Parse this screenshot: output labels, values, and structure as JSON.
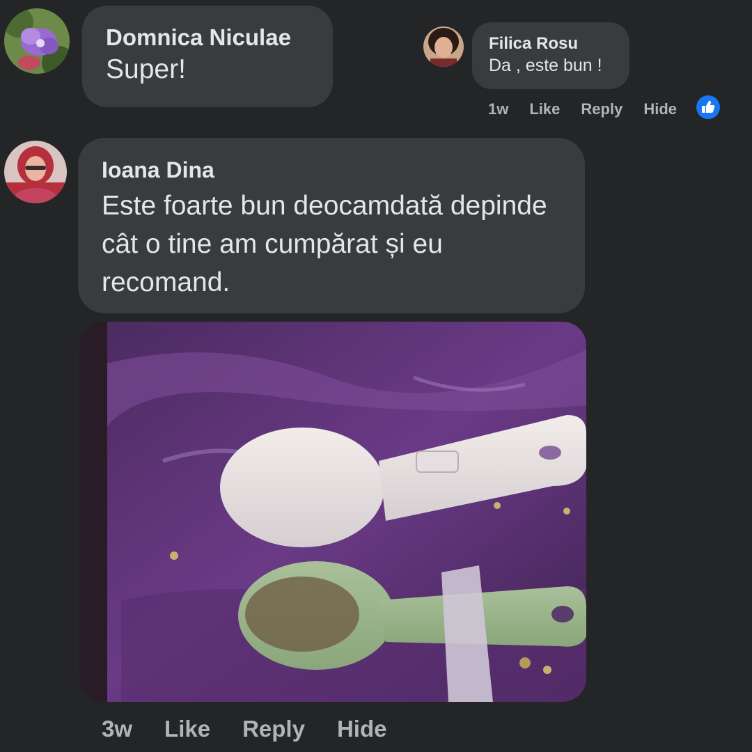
{
  "comments": [
    {
      "author": "Domnica Niculae",
      "text": "Super!",
      "avatar": "flowers-avatar"
    },
    {
      "author": "Ioana Dina",
      "text": "Este foarte bun deocamdată depinde cât o tine am cumpărat și eu recomand.",
      "avatar": "profile-photo-avatar",
      "attachment": "photo-of-spoons",
      "actions": {
        "time": "3w",
        "like": "Like",
        "reply": "Reply",
        "hide": "Hide"
      }
    }
  ],
  "reply": {
    "author": "Filica Rosu",
    "text": "Da , este bun !",
    "avatar": "profile-photo-avatar",
    "actions": {
      "time": "1w",
      "like": "Like",
      "reply": "Reply",
      "hide": "Hide"
    },
    "reaction_icon": "thumbs-up-icon"
  },
  "colors": {
    "background": "#242526",
    "bubble": "#3a3b3c",
    "primary_text": "#e4e6eb",
    "secondary_text": "#b0b3b8",
    "like_blue": "#1877f2"
  }
}
